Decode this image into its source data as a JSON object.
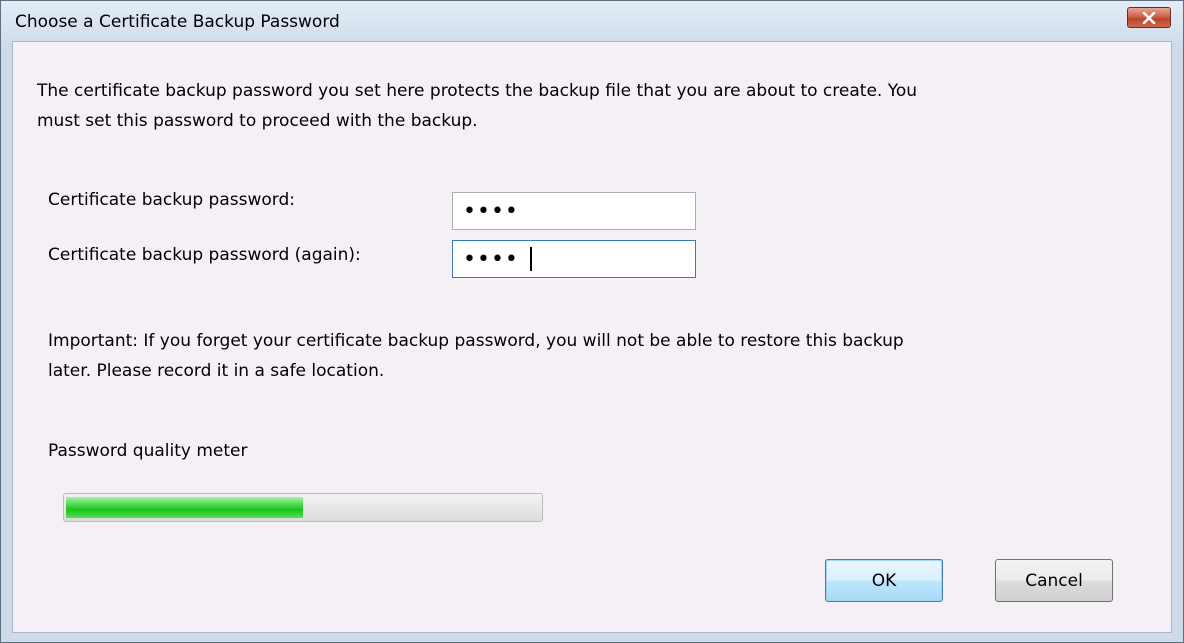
{
  "window": {
    "title": "Choose a Certificate Backup Password",
    "close_icon": "close-icon"
  },
  "intro": {
    "line1": "The certificate backup password you set here protects the backup file that you are about to create. You",
    "line2": "must set this password to proceed with the backup."
  },
  "fields": {
    "password_label": "Certificate backup password:",
    "password_value": "••••",
    "confirm_label": "Certificate backup password (again):",
    "confirm_value": "••••"
  },
  "warning": {
    "line1": "Important: If you forget your certificate backup password, you will not be able to restore this backup",
    "line2": "later. Please record it in a safe location."
  },
  "meter": {
    "label": "Password quality meter",
    "level_percent": 50,
    "fill_color": "#1fc81f"
  },
  "buttons": {
    "ok_label": "OK",
    "cancel_label": "Cancel"
  },
  "colors": {
    "close_button": "#c95a44",
    "dialog_background": "#f5f0f5",
    "default_button_border": "#3c7fb1"
  }
}
